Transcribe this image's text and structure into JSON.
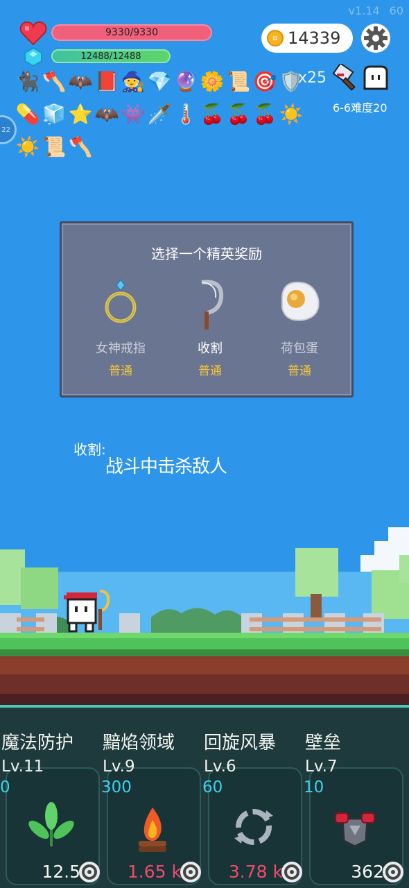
{
  "meta": {
    "version": "v1.14",
    "fps": "60"
  },
  "player": {
    "hp": "9330/9330",
    "mp": "12488/12488"
  },
  "coins": {
    "value": "14339",
    "icon": "coin-icon"
  },
  "items": {
    "multiplier": "x25",
    "row1": [
      "🐈‍⬛",
      "🪓",
      "🦇",
      "📕",
      "🧙",
      "💎",
      "🔮",
      "🌼",
      "📜",
      "🎯",
      "🛡️"
    ],
    "row2": [
      "💊",
      "🧊",
      "⭐",
      "🦇",
      "👾",
      "🗡️",
      "🌡️",
      "🍒",
      "🍒",
      "🍒",
      "☀️"
    ],
    "row3": [
      "☀️",
      "📜",
      "🪓"
    ]
  },
  "stage": {
    "label": "6-6难度20",
    "side_badge": "22"
  },
  "reward_panel": {
    "title": "选择一个精英奖励",
    "rewards": [
      {
        "name": "女神戒指",
        "rarity": "普通",
        "icon": "ring-icon"
      },
      {
        "name": "收割",
        "rarity": "普通",
        "icon": "sickle-icon"
      },
      {
        "name": "荷包蛋",
        "rarity": "普通",
        "icon": "fried-egg-icon"
      }
    ]
  },
  "description": {
    "label": "收割:",
    "text": "战斗中击杀敌人"
  },
  "skills": [
    {
      "name": "魔法防护",
      "level": "Lv.11",
      "value": "0",
      "cost": "12.5",
      "cost_color": "white",
      "icon": "leaf-icon"
    },
    {
      "name": "黯焰领域",
      "level": "Lv.9",
      "value": "300",
      "cost": "1.65 k",
      "cost_color": "red",
      "icon": "campfire-icon"
    },
    {
      "name": "回旋风暴",
      "level": "Lv.6",
      "value": "60",
      "cost": "3.78 k",
      "cost_color": "red",
      "icon": "whirlwind-icon"
    },
    {
      "name": "壁垒",
      "level": "Lv.7",
      "value": "10",
      "cost": "362",
      "cost_color": "white",
      "icon": "armor-icon"
    }
  ],
  "colors": {
    "sky": "#2d95ea",
    "hp": "#f0607a",
    "mp": "#5fd46a",
    "rarity": "#f3c33b",
    "skill_bg": "#1f3a3d",
    "skill_value": "#3ad1ec",
    "cost_red": "#f04a6a"
  }
}
